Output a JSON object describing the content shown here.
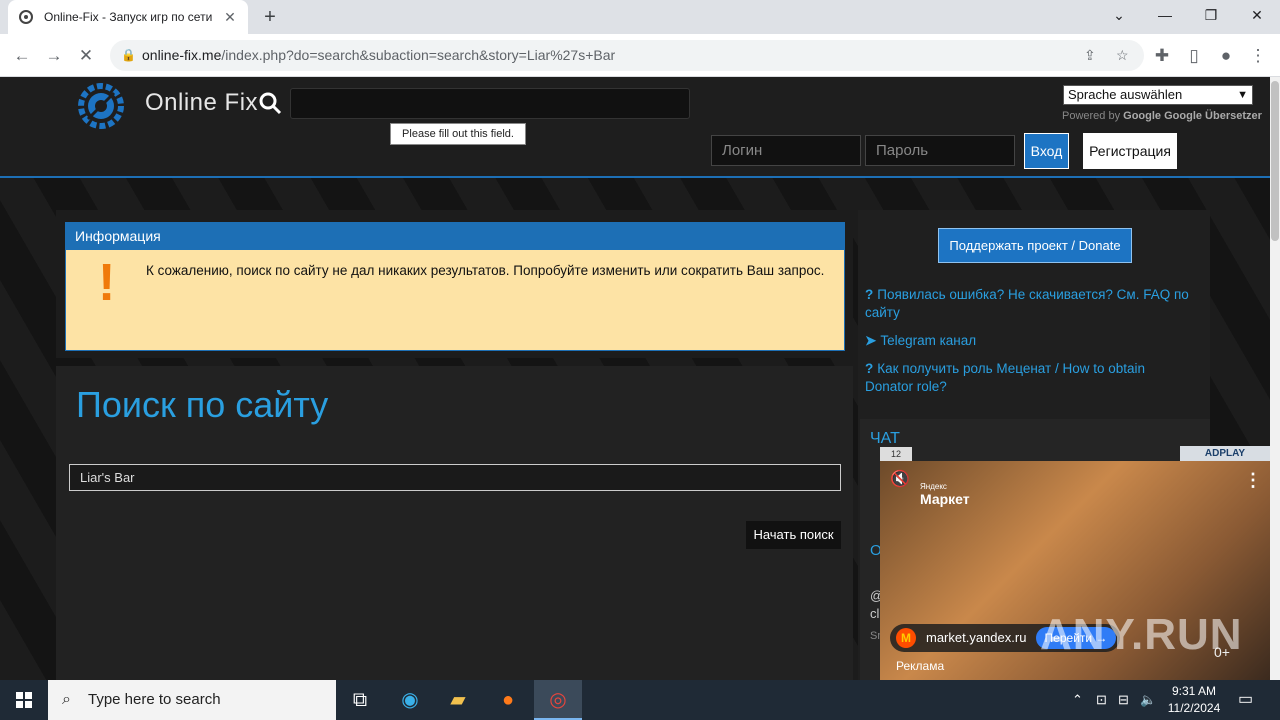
{
  "browser": {
    "tab_title": "Online-Fix - Запуск игр по сети",
    "url_host": "online-fix.me",
    "url_path": "/index.php?do=search&subaction=search&story=Liar%27s+Bar"
  },
  "site": {
    "name": "Online Fix",
    "search_tooltip": "Please fill out this field.",
    "lang_select": "Sprache auswählen",
    "powered_by": "Powered by",
    "google": "Google",
    "translate": "Google Übersetzer",
    "login_placeholder": "Логин",
    "password_placeholder": "Пароль",
    "login_button": "Вход",
    "register_button": "Регистрация"
  },
  "info": {
    "heading": "Информация",
    "icon": "!",
    "message": "К сожалению, поиск по сайту не дал никаких результатов. Попробуйте изменить или сократить Ваш запрос."
  },
  "search": {
    "title": "Поиск по сайту",
    "query": "Liar's Bar",
    "button": "Начать поиск"
  },
  "sidebar": {
    "donate_button": "Поддержать проект / Donate",
    "links": [
      "Появилась ошибка? Не скачивается? См. FAQ по сайту",
      "Telegram канал",
      "Как получить роль Меценат / How to obtain Donator role?"
    ],
    "chat_title": "ЧАТ",
    "snippet_o": "О",
    "snippet_at": "@",
    "snippet_cl": "cl",
    "snippet_sn": "Sn"
  },
  "ad": {
    "counter": "12",
    "network": "ADPLAY",
    "brand_small": "Яндекс",
    "brand": "Маркет",
    "domain": "market.yandex.ru",
    "cta": "Перейти →",
    "label": "Реклама",
    "age": "0+",
    "watermark": "ANY.RUN"
  },
  "taskbar": {
    "search_placeholder": "Type here to search",
    "time": "9:31 AM",
    "date": "11/2/2024"
  }
}
